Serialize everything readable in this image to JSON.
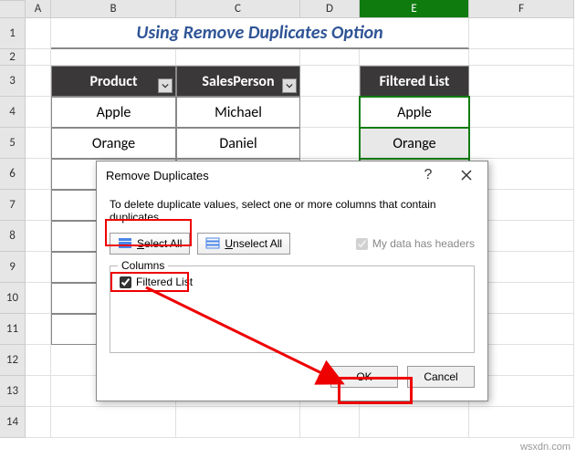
{
  "columns": [
    "A",
    "B",
    "C",
    "D",
    "E",
    "F"
  ],
  "rows": [
    "1",
    "2",
    "3",
    "4",
    "5",
    "6",
    "7",
    "8",
    "9",
    "10",
    "11",
    "12",
    "13",
    "14"
  ],
  "title": "Using Remove Duplicates Option",
  "table": {
    "headers": {
      "product": "Product",
      "salesperson": "SalesPerson",
      "filtered": "Filtered List"
    },
    "rows": [
      {
        "product": "Apple",
        "salesperson": "Michael",
        "filtered": "Apple"
      },
      {
        "product": "Orange",
        "salesperson": "Daniel",
        "filtered": "Orange"
      }
    ]
  },
  "dialog": {
    "title": "Remove Duplicates",
    "instruction": "To delete duplicate values, select one or more columns that contain duplicates.",
    "select_all": "Select All",
    "unselect_all": "Unselect All",
    "headers_cb": "My data has headers",
    "group_label": "Columns",
    "item": "Filtered List",
    "ok": "OK",
    "cancel": "Cancel"
  },
  "watermark": "wsxdn.com",
  "chart_data": {
    "type": "table",
    "title": "Using Remove Duplicates Option",
    "columns": [
      "Product",
      "SalesPerson",
      "Filtered List"
    ],
    "rows": [
      [
        "Apple",
        "Michael",
        "Apple"
      ],
      [
        "Orange",
        "Daniel",
        "Orange"
      ]
    ]
  }
}
